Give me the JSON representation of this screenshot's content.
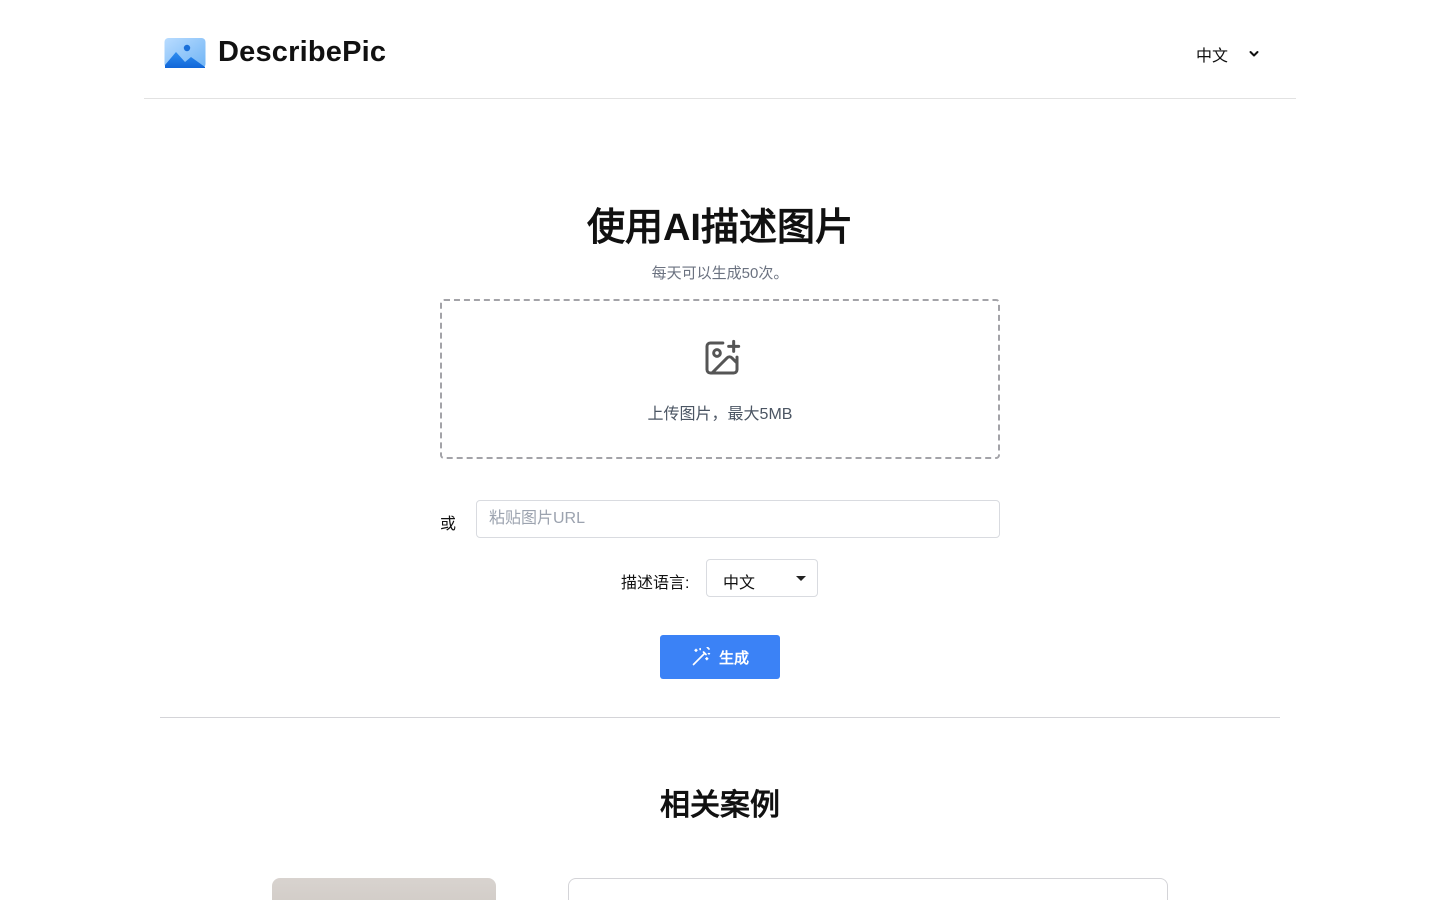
{
  "header": {
    "brand_name": "DescribePic",
    "language": "中文",
    "logo_icon": "image-landscape-icon",
    "chevron_icon": "chevron-down-icon"
  },
  "hero": {
    "title": "使用AI描述图片",
    "subtitle": "每天可以生成50次。"
  },
  "upload": {
    "text": "上传图片，最大5MB",
    "icon": "image-plus-icon"
  },
  "url": {
    "or_label": "或",
    "placeholder": "粘贴图片URL",
    "value": ""
  },
  "description_language": {
    "label": "描述语言:",
    "selected": "中文"
  },
  "generate": {
    "label": "生成",
    "icon": "magic-wand-icon"
  },
  "cases": {
    "title": "相关案例"
  },
  "colors": {
    "primary": "#3b82f6",
    "muted_text": "#6b7280",
    "border": "#d9dbe0"
  }
}
